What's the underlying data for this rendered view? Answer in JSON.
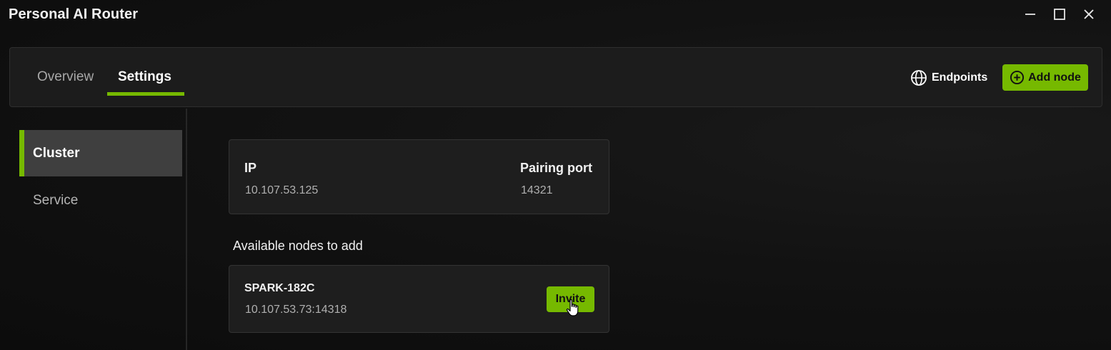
{
  "window": {
    "title": "Personal AI Router",
    "controls": [
      "minimize-icon",
      "maximize-icon",
      "close-icon"
    ]
  },
  "tabs": [
    {
      "label": "Overview",
      "active": false
    },
    {
      "label": "Settings",
      "active": true
    }
  ],
  "header_actions": {
    "endpoints_label": "Endpoints",
    "endpoints_icon": "globe-icon",
    "add_node_label": "Add node",
    "add_node_icon": "plus-circle-icon"
  },
  "sidebar": {
    "items": [
      {
        "label": "Cluster",
        "active": true
      },
      {
        "label": "Service",
        "active": false
      }
    ]
  },
  "cluster": {
    "ip_label": "IP",
    "ip_value": "10.107.53.125",
    "port_label": "Pairing port",
    "port_value": "14321"
  },
  "available_nodes": {
    "heading": "Available nodes to add",
    "nodes": [
      {
        "name": "SPARK-182C",
        "address": "10.107.53.73:14318",
        "action_label": "Invite"
      }
    ]
  },
  "colors": {
    "accent": "#76b900",
    "background": "#121212",
    "card": "#1e1e1e"
  }
}
